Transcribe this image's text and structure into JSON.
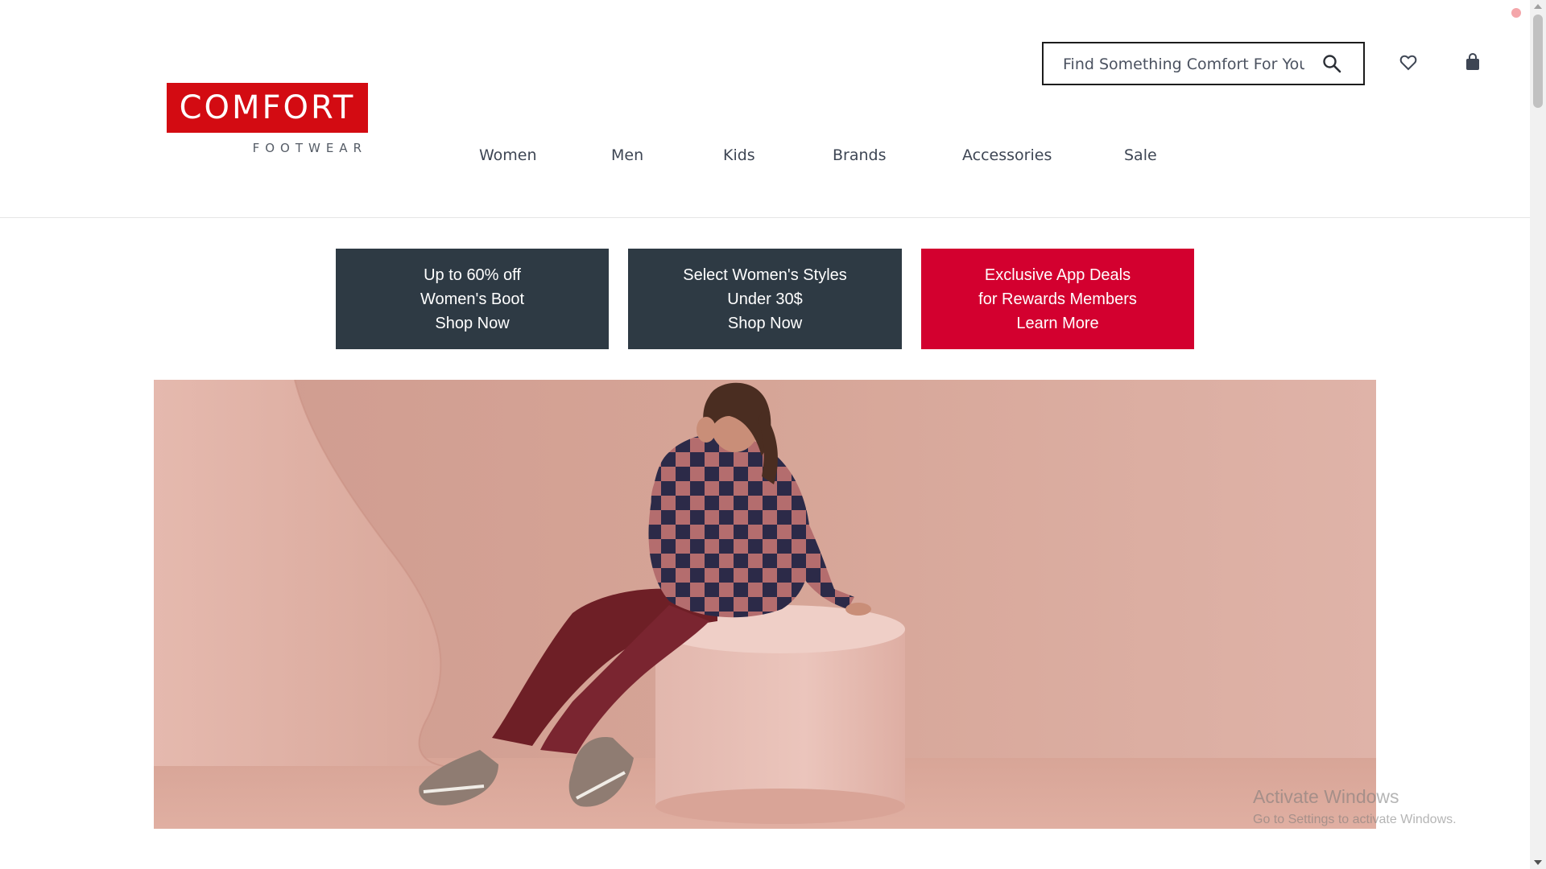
{
  "header": {
    "logo": {
      "main": "COMFORT",
      "sub": "FOOTWEAR"
    },
    "search": {
      "placeholder": "Find Something Comfort For You",
      "value": ""
    },
    "icons": {
      "search": "search-icon",
      "wishlist": "heart-icon",
      "cart": "shopping-bag-icon"
    }
  },
  "nav": {
    "items": [
      {
        "label": "Women"
      },
      {
        "label": "Men"
      },
      {
        "label": "Kids"
      },
      {
        "label": "Brands"
      },
      {
        "label": "Accessories"
      },
      {
        "label": "Sale"
      }
    ]
  },
  "promos": [
    {
      "line1": "Up to 60% off",
      "line2": "Women's Boot",
      "line3": "Shop Now",
      "color": "#2e3a44"
    },
    {
      "line1": "Select Women's Styles",
      "line2": "Under 30$",
      "line3": "Shop Now",
      "color": "#2e3a44"
    },
    {
      "line1": "Exclusive App Deals",
      "line2": "for Rewards Members",
      "line3": "Learn More",
      "color": "#d3002f"
    }
  ],
  "watermark": {
    "title": "Activate Windows",
    "subtitle": "Go to Settings to activate Windows."
  },
  "colors": {
    "brand_red": "#d30b12",
    "promo_dark": "#2e3a44",
    "promo_red": "#d3002f",
    "hero_bg": "#d7a598"
  }
}
